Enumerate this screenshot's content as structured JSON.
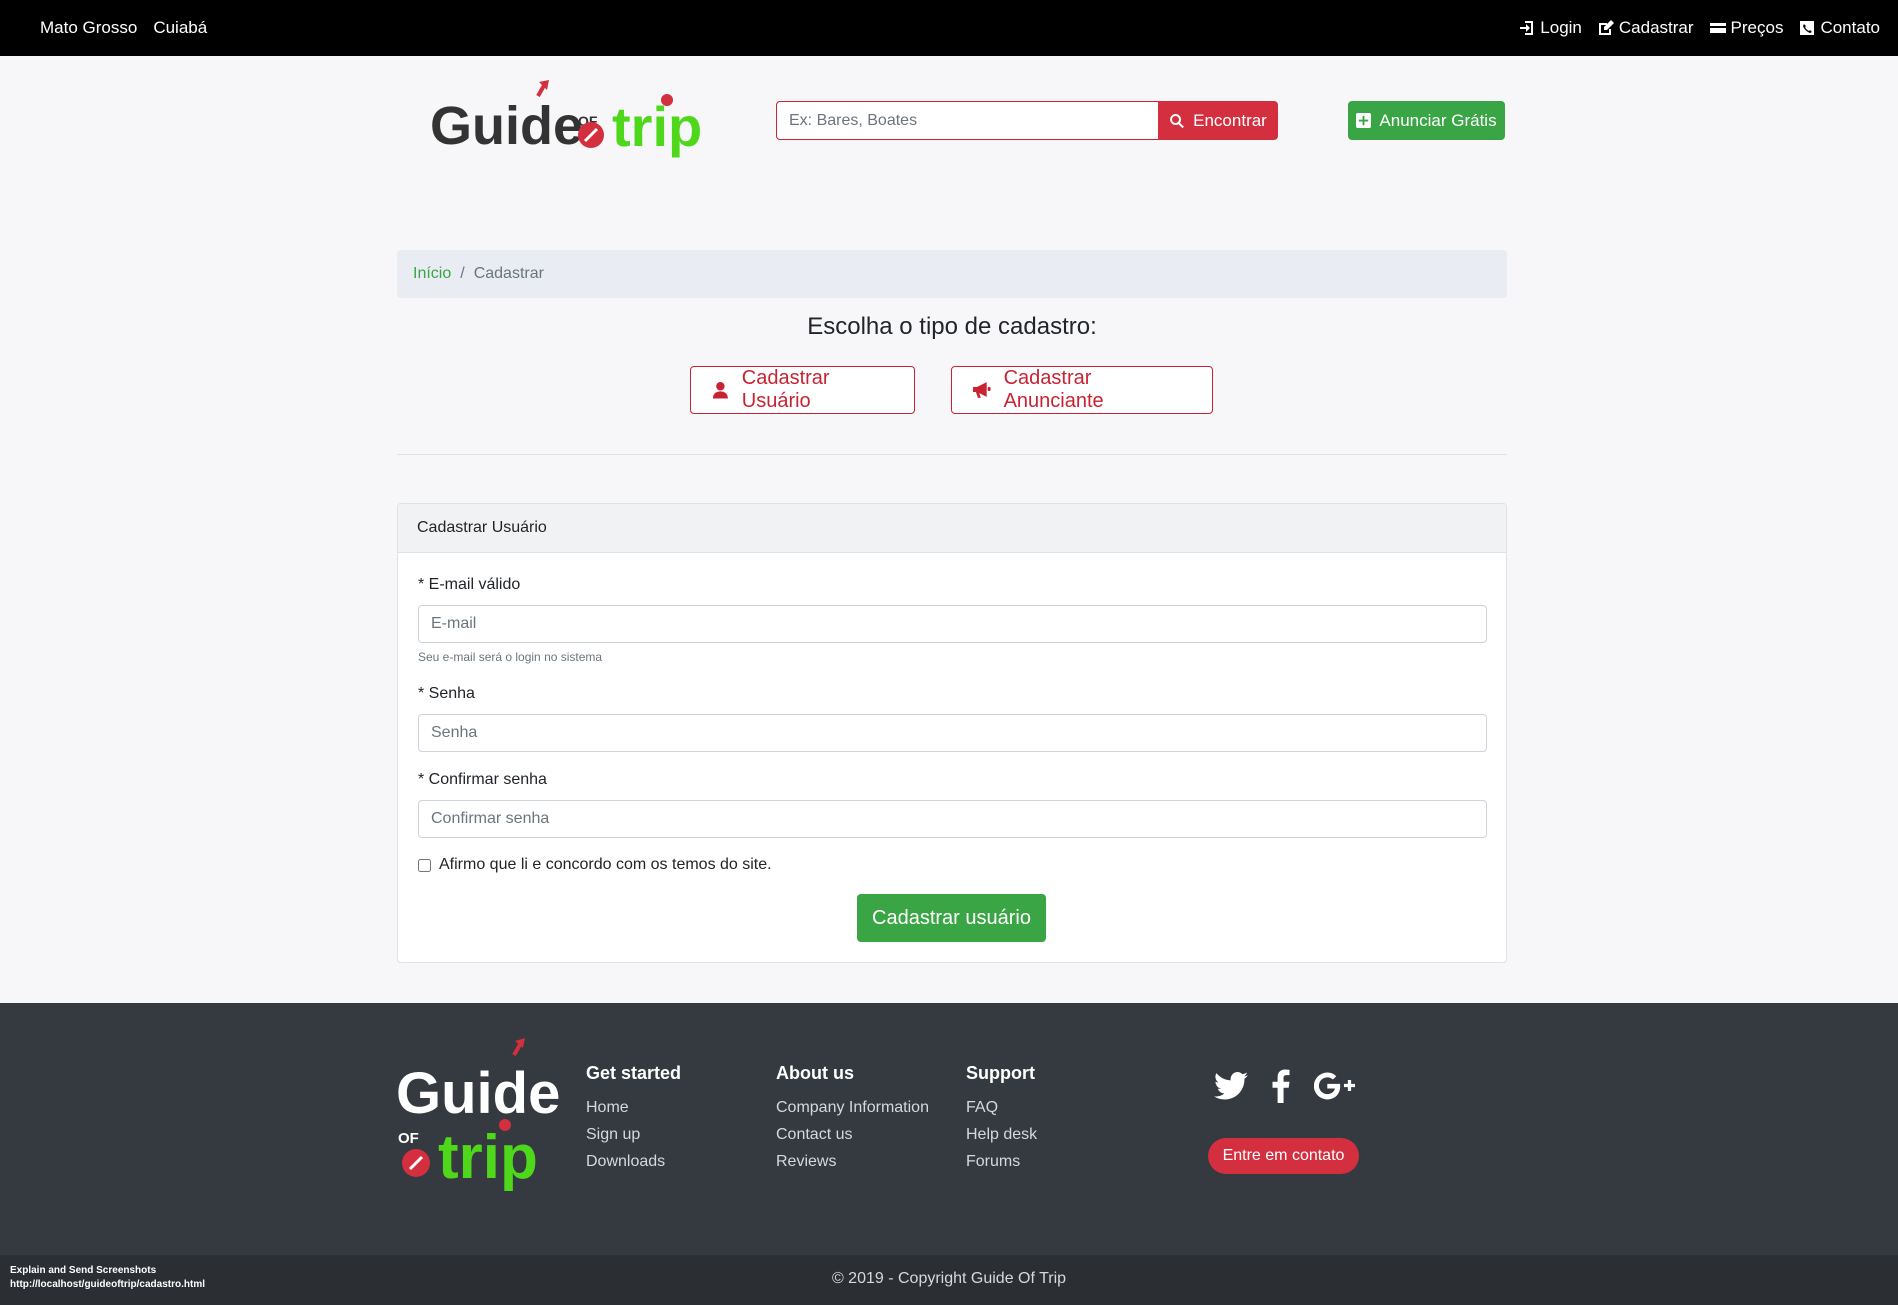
{
  "topbar": {
    "state": "Mato Grosso",
    "city": "Cuiabá",
    "nav": {
      "login": "Login",
      "register": "Cadastrar",
      "prices": "Preços",
      "contact": "Contato"
    }
  },
  "header": {
    "logo_text": "Guide Of Trip",
    "search_placeholder": "Ex: Bares, Boates",
    "search_button": "Encontrar",
    "advertise_button": "Anunciar Grátis"
  },
  "breadcrumb": {
    "home": "Início",
    "separator": "/",
    "current": "Cadastrar"
  },
  "choose": {
    "title": "Escolha o tipo de cadastro:",
    "user_button": "Cadastrar Usuário",
    "advertiser_button": "Cadastrar Anunciante"
  },
  "form": {
    "header": "Cadastrar Usuário",
    "email_label": "* E-mail válido",
    "email_placeholder": "E-mail",
    "email_help": "Seu e-mail será o login no sistema",
    "password_label": "* Senha",
    "password_placeholder": "Senha",
    "confirm_label": "* Confirmar senha",
    "confirm_placeholder": "Confirmar senha",
    "terms_label": "Afirmo que li e concordo com os temos do site.",
    "terms_checked": false,
    "submit": "Cadastrar usuário"
  },
  "footer": {
    "get_started": {
      "title": "Get started",
      "links": [
        "Home",
        "Sign up",
        "Downloads"
      ]
    },
    "about": {
      "title": "About us",
      "links": [
        "Company Information",
        "Contact us",
        "Reviews"
      ]
    },
    "support": {
      "title": "Support",
      "links": [
        "FAQ",
        "Help desk",
        "Forums"
      ]
    },
    "social": [
      "twitter-icon",
      "facebook-icon",
      "google-plus-icon"
    ],
    "contact_button": "Entre em contato",
    "copyright": "© 2019 - Copyright Guide Of Trip"
  },
  "extension_overlay": {
    "title": "Explain and Send Screenshots",
    "url": "http://localhost/guideoftrip/cadastro.html"
  },
  "colors": {
    "brand_green": "#3aa545",
    "brand_red": "#d32f3f",
    "logo_lime": "#4fd81b",
    "topbar": "#000000",
    "footer": "#343a40"
  }
}
